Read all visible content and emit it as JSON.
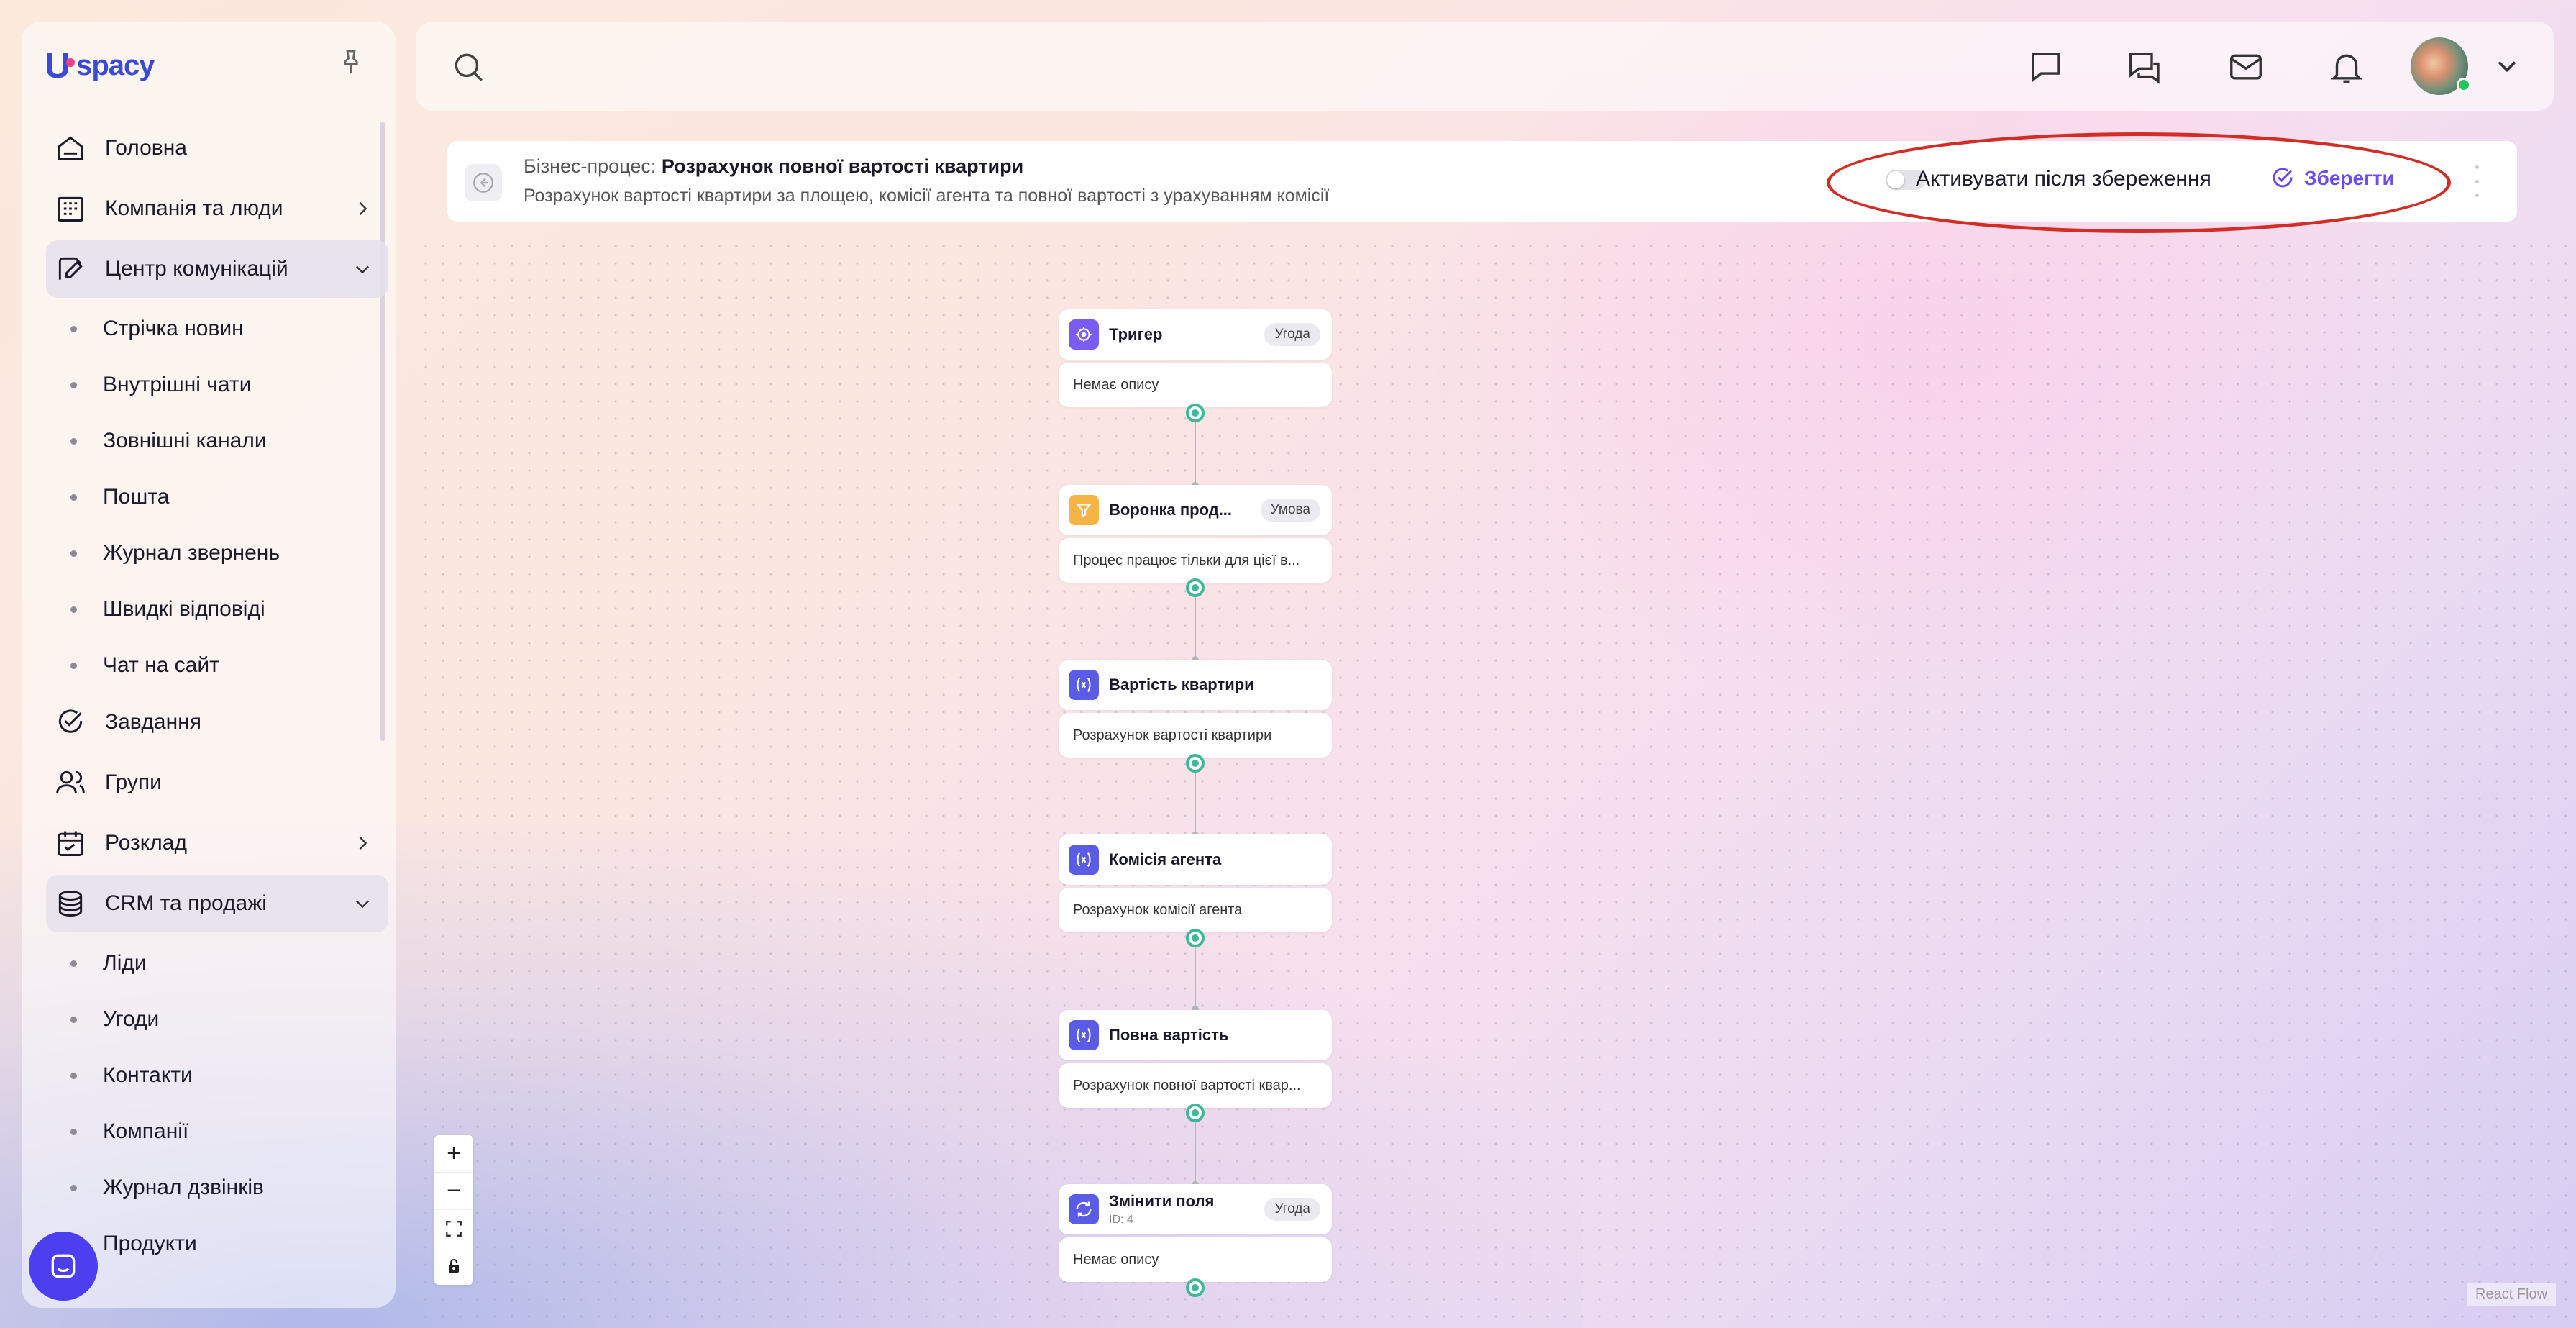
{
  "app": {
    "logo_u": "U",
    "logo_text": "spacy"
  },
  "sidebar": {
    "items": [
      {
        "label": "Головна"
      },
      {
        "label": "Компанія та люди"
      },
      {
        "label": "Центр комунікацій"
      }
    ],
    "comm_sub": [
      "Стрічка новин",
      "Внутрішні чати",
      "Зовнішні канали",
      "Пошта",
      "Журнал звернень",
      "Швидкі відповіді",
      "Чат на сайт"
    ],
    "items2": [
      {
        "label": "Завдання"
      },
      {
        "label": "Групи"
      },
      {
        "label": "Розклад"
      },
      {
        "label": "CRM та продажі"
      }
    ],
    "crm_sub": [
      "Ліди",
      "Угоди",
      "Контакти",
      "Компанії",
      "Журнал дзвінків",
      "Продукти"
    ]
  },
  "header": {
    "prefix": "Бізнес-процес:",
    "title": "Розрахунок повної вартості квартири",
    "description": "Розрахунок вартості квартири за площею, комісії агента та повної вартості з урахуванням комісії",
    "activate_label": "Активувати після збереження",
    "save_label": "Зберегти"
  },
  "flow": {
    "nodes": [
      {
        "title": "Тригер",
        "tag": "Угода",
        "desc": "Немає опису"
      },
      {
        "title": "Воронка прод...",
        "tag": "Умова",
        "desc": "Процес працює тільки для цієї в..."
      },
      {
        "title": "Вартість квартири",
        "tag": "",
        "desc": "Розрахунок вартості квартири"
      },
      {
        "title": "Комісія агента",
        "tag": "",
        "desc": "Розрахунок комісії агента"
      },
      {
        "title": "Повна вартість",
        "tag": "",
        "desc": "Розрахунок повної вартості квар..."
      },
      {
        "title": "Змінити поля",
        "sub": "ID: 4",
        "tag": "Угода",
        "desc": "Немає опису"
      }
    ]
  },
  "zoom": {
    "plus": "+",
    "minus": "−"
  },
  "attribution": "React Flow",
  "colors": {
    "accent": "#6c4cf0",
    "trigger": "#7b5cf0",
    "condition": "#f5b443",
    "variable": "#5b5ce6",
    "handle": "#3db89a",
    "highlight": "#d22e26"
  }
}
